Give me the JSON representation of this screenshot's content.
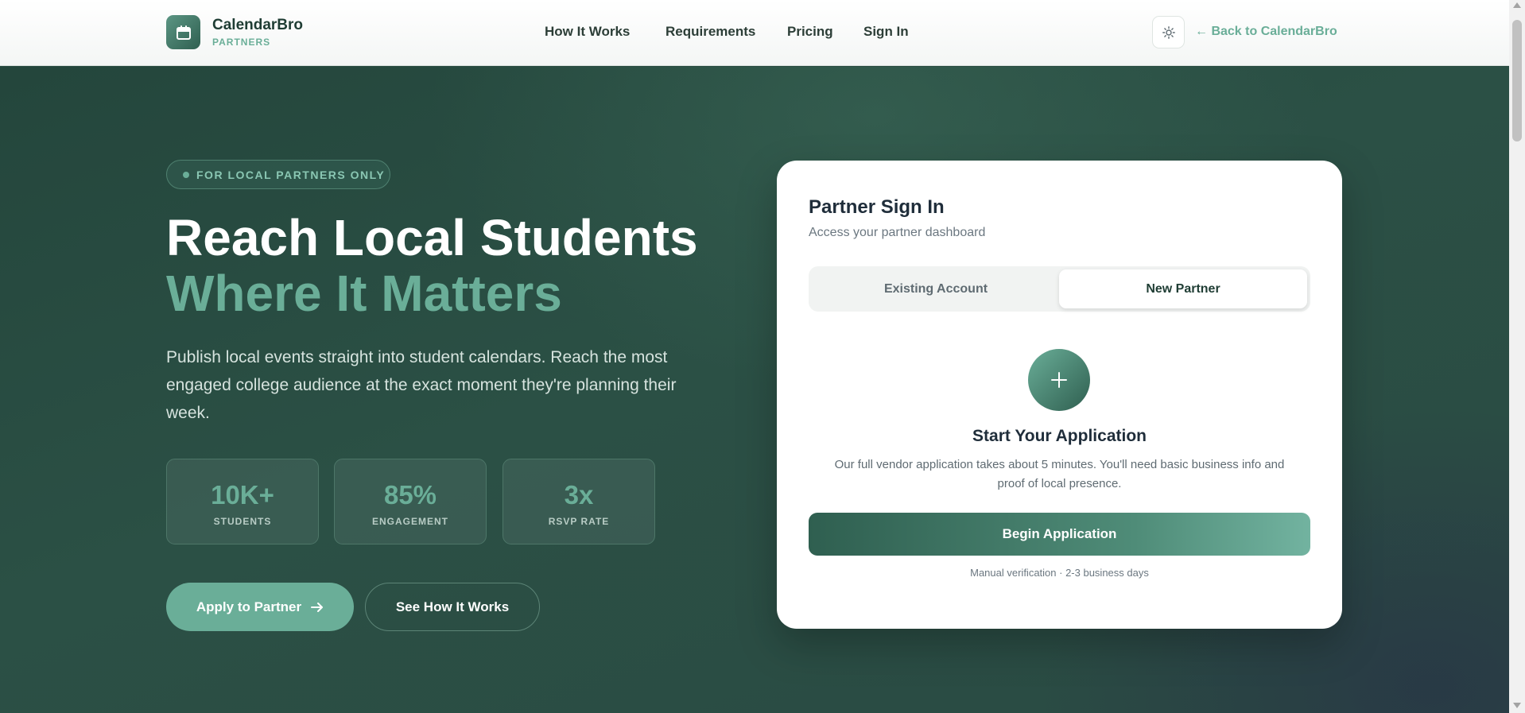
{
  "header": {
    "brand_name": "CalendarBro",
    "brand_sub": "PARTNERS",
    "nav": [
      "How It Works",
      "Requirements",
      "Pricing",
      "Sign In"
    ],
    "back_link": "← Back to CalendarBro"
  },
  "hero": {
    "pill": "FOR LOCAL PARTNERS ONLY",
    "title_line1": "Reach Local Students",
    "title_line2": "Where It Matters",
    "description": "Publish local events straight into student calendars. Reach the most engaged college audience at the exact moment they're planning their week.",
    "stats": [
      {
        "value": "10K+",
        "label": "STUDENTS"
      },
      {
        "value": "85%",
        "label": "ENGAGEMENT"
      },
      {
        "value": "3x",
        "label": "RSVP RATE"
      }
    ],
    "apply_button": "Apply to Partner",
    "how_button": "See How It Works"
  },
  "card": {
    "title": "Partner Sign In",
    "subtitle": "Access your partner dashboard",
    "tabs": [
      "Existing Account",
      "New Partner"
    ],
    "active_tab": "New Partner",
    "start_title": "Start Your Application",
    "start_desc": "Our full vendor application takes about 5 minutes. You'll need basic business info and proof of local presence.",
    "begin_button": "Begin Application",
    "verify_note": "Manual verification · 2-3 business days"
  },
  "colors": {
    "accent": "#6aae98",
    "dark_green": "#2a4c42"
  },
  "icons": {
    "logo": "calendar-icon",
    "theme": "sun-icon",
    "apply_arrow": "arrow-right-icon",
    "new_partner": "plus-icon"
  }
}
